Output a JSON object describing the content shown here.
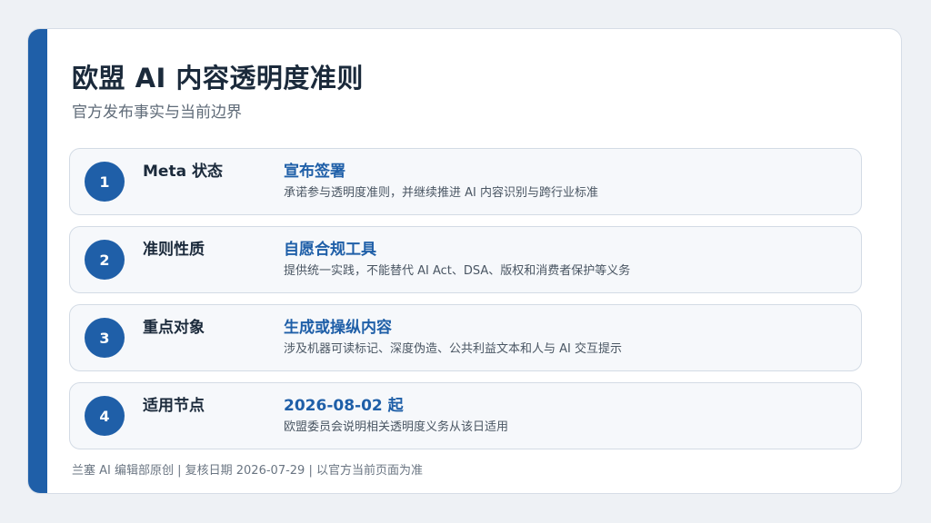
{
  "slide": {
    "title": "欧盟 AI 内容透明度准则",
    "subtitle": "官方发布事实与当前边界",
    "items": [
      {
        "number": "1",
        "label": "Meta 状态",
        "value": "宣布签署",
        "description": "承诺参与透明度准则，并继续推进 AI 内容识别与跨行业标准"
      },
      {
        "number": "2",
        "label": "准则性质",
        "value": "自愿合规工具",
        "description": "提供统一实践，不能替代 AI Act、DSA、版权和消费者保护等义务"
      },
      {
        "number": "3",
        "label": "重点对象",
        "value": "生成或操纵内容",
        "description": "涉及机器可读标记、深度伪造、公共利益文本和人与 AI 交互提示"
      },
      {
        "number": "4",
        "label": "适用节点",
        "value": "2026-08-02 起",
        "description": "欧盟委员会说明相关透明度义务从该日适用"
      }
    ],
    "footer": "兰塞 AI 编辑部原创 | 复核日期 2026-07-29 | 以官方当前页面为准"
  },
  "colors": {
    "accent": "#1f5fa8",
    "title": "#1b2a3b",
    "card_background": "#f6f8fb"
  }
}
